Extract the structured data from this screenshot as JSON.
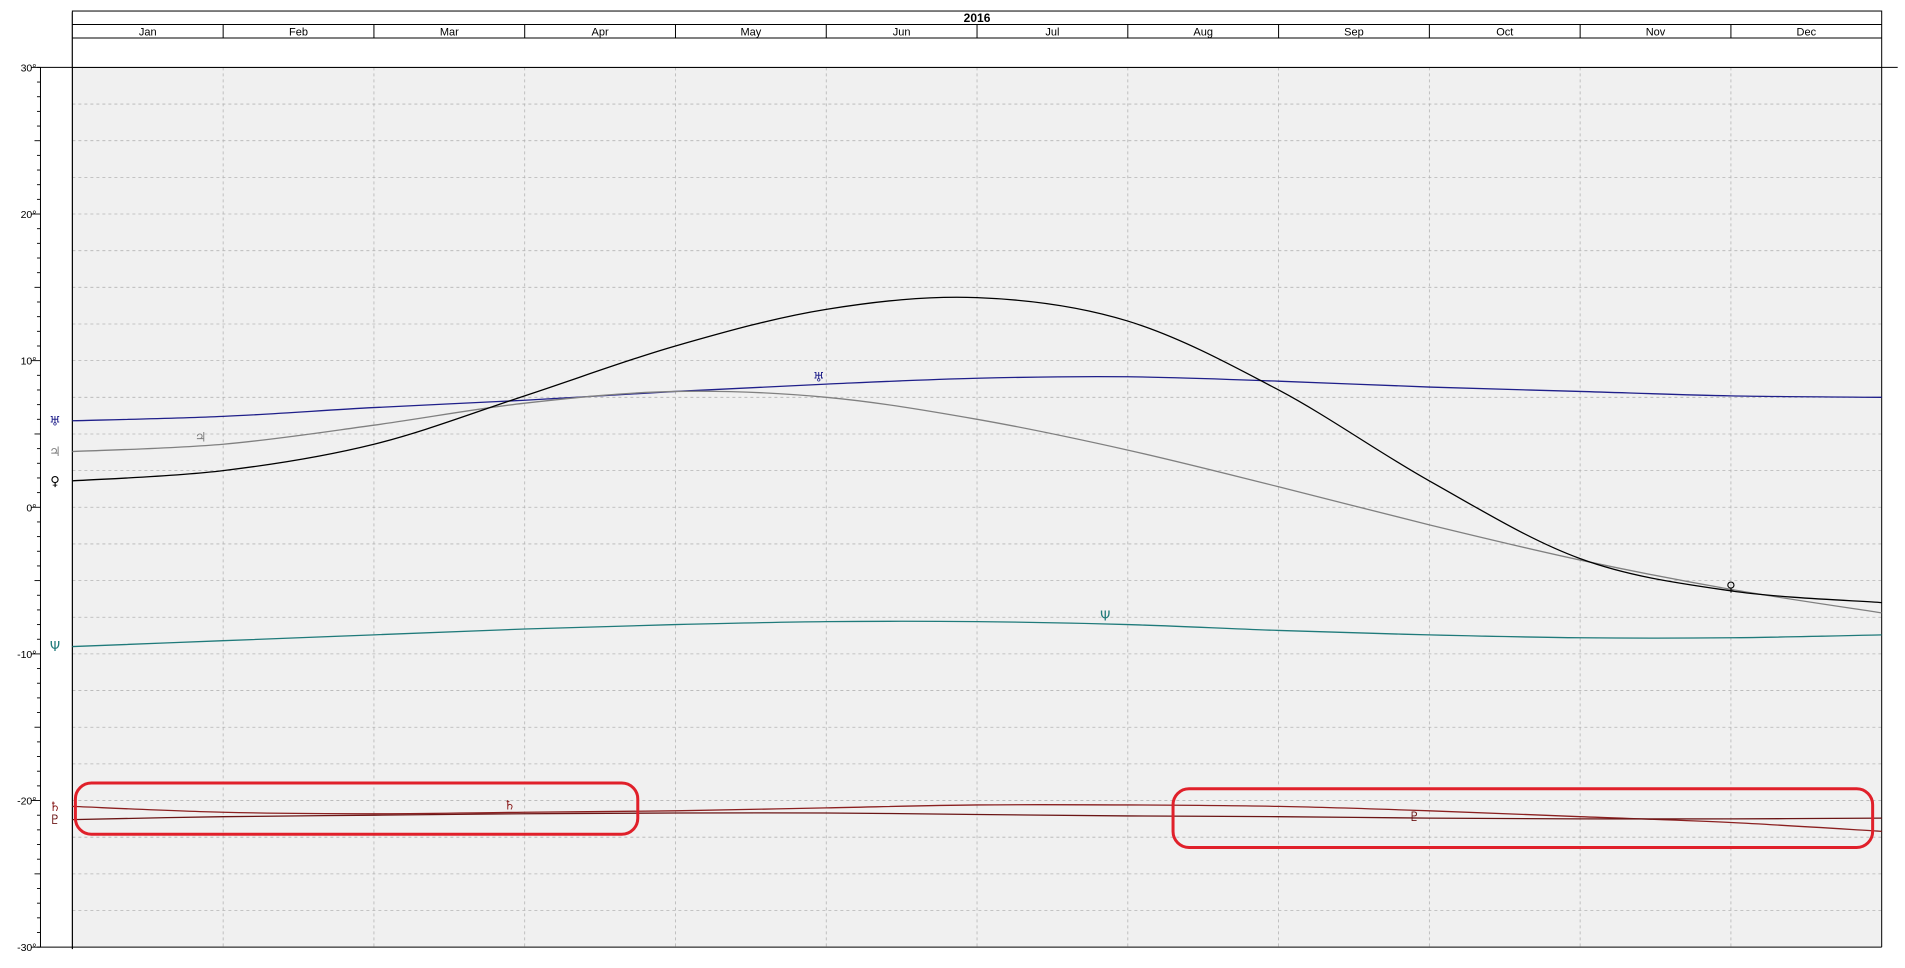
{
  "chart_data": {
    "type": "line",
    "title": "2016",
    "categories": [
      "Jan",
      "Feb",
      "Mar",
      "Apr",
      "May",
      "Jun",
      "Jul",
      "Aug",
      "Sep",
      "Oct",
      "Nov",
      "Dec"
    ],
    "x_unit": "month (1 = start of Jan, 13 = end of Dec)",
    "xlim": [
      1,
      13
    ],
    "ylim": [
      -30,
      30
    ],
    "y_ticks": [
      {
        "value": 30,
        "label": "30°"
      },
      {
        "value": 20,
        "label": "20°"
      },
      {
        "value": 10,
        "label": "10°"
      },
      {
        "value": 0,
        "label": "0°"
      },
      {
        "value": -10,
        "label": "-10°"
      },
      {
        "value": -20,
        "label": "-20°"
      },
      {
        "value": -30,
        "label": "-30°"
      }
    ],
    "grid": true,
    "series": [
      {
        "glyph": "♅",
        "color": "#1f1f8a",
        "x": [
          1,
          2,
          3,
          4,
          5,
          6,
          7,
          8,
          9,
          10,
          11,
          12,
          13
        ],
        "y": [
          5.9,
          6.2,
          6.8,
          7.3,
          7.9,
          8.4,
          8.8,
          8.9,
          8.6,
          8.2,
          7.9,
          7.6,
          7.5
        ],
        "label_at": {
          "x": 5.95,
          "y": 8.9
        }
      },
      {
        "glyph": "♃",
        "color": "#808080",
        "x": [
          1,
          2,
          3,
          4,
          5,
          6,
          7,
          8,
          9,
          10,
          11,
          12,
          13
        ],
        "y": [
          3.8,
          4.3,
          5.6,
          7.1,
          7.9,
          7.5,
          6.0,
          3.9,
          1.4,
          -1.2,
          -3.6,
          -5.6,
          -7.2
        ],
        "label_at": {
          "x": 1.85,
          "y": 4.8
        }
      },
      {
        "glyph": "♀",
        "color": "#000000",
        "x": [
          1,
          2,
          3,
          4,
          5,
          6,
          7,
          8,
          9,
          10,
          11,
          12,
          13
        ],
        "y": [
          1.8,
          2.5,
          4.3,
          7.6,
          11.0,
          13.5,
          14.3,
          12.7,
          8.0,
          1.8,
          -3.5,
          -5.7,
          -6.5
        ],
        "label_at": {
          "x": 12.0,
          "y": -5.4
        }
      },
      {
        "glyph": "Ψ",
        "color": "#1f7a7a",
        "x": [
          1,
          2,
          3,
          4,
          5,
          6,
          7,
          8,
          9,
          10,
          11,
          12,
          13
        ],
        "y": [
          -9.5,
          -9.1,
          -8.7,
          -8.3,
          -8.0,
          -7.8,
          -7.8,
          -8.0,
          -8.4,
          -8.7,
          -8.9,
          -8.9,
          -8.7
        ],
        "label_at": {
          "x": 7.85,
          "y": -7.4
        }
      },
      {
        "glyph": "♄",
        "color": "#8b2020",
        "x": [
          1,
          2,
          3,
          4,
          5,
          6,
          7,
          8,
          9,
          10,
          11,
          12,
          13
        ],
        "y": [
          -20.4,
          -20.8,
          -20.9,
          -20.8,
          -20.7,
          -20.5,
          -20.3,
          -20.3,
          -20.4,
          -20.7,
          -21.1,
          -21.5,
          -22.1
        ],
        "label_at": {
          "x": 3.9,
          "y": -20.3
        }
      },
      {
        "glyph": "♇",
        "color": "#6b1515",
        "x": [
          1,
          2,
          3,
          4,
          5,
          6,
          7,
          8,
          9,
          10,
          11,
          12,
          13
        ],
        "y": [
          -21.3,
          -21.1,
          -21.0,
          -20.9,
          -20.85,
          -20.85,
          -20.95,
          -21.05,
          -21.1,
          -21.2,
          -21.25,
          -21.25,
          -21.2
        ],
        "label_at": {
          "x": 9.9,
          "y": -21.1
        }
      }
    ],
    "annotations": [
      {
        "type": "rounded-rect",
        "color": "#e0202a",
        "x_range": [
          1.02,
          4.75
        ],
        "y_range": [
          -22.3,
          -18.8
        ]
      },
      {
        "type": "rounded-rect",
        "color": "#e0202a",
        "x_range": [
          8.3,
          12.94
        ],
        "y_range": [
          -23.2,
          -19.2
        ]
      }
    ]
  }
}
